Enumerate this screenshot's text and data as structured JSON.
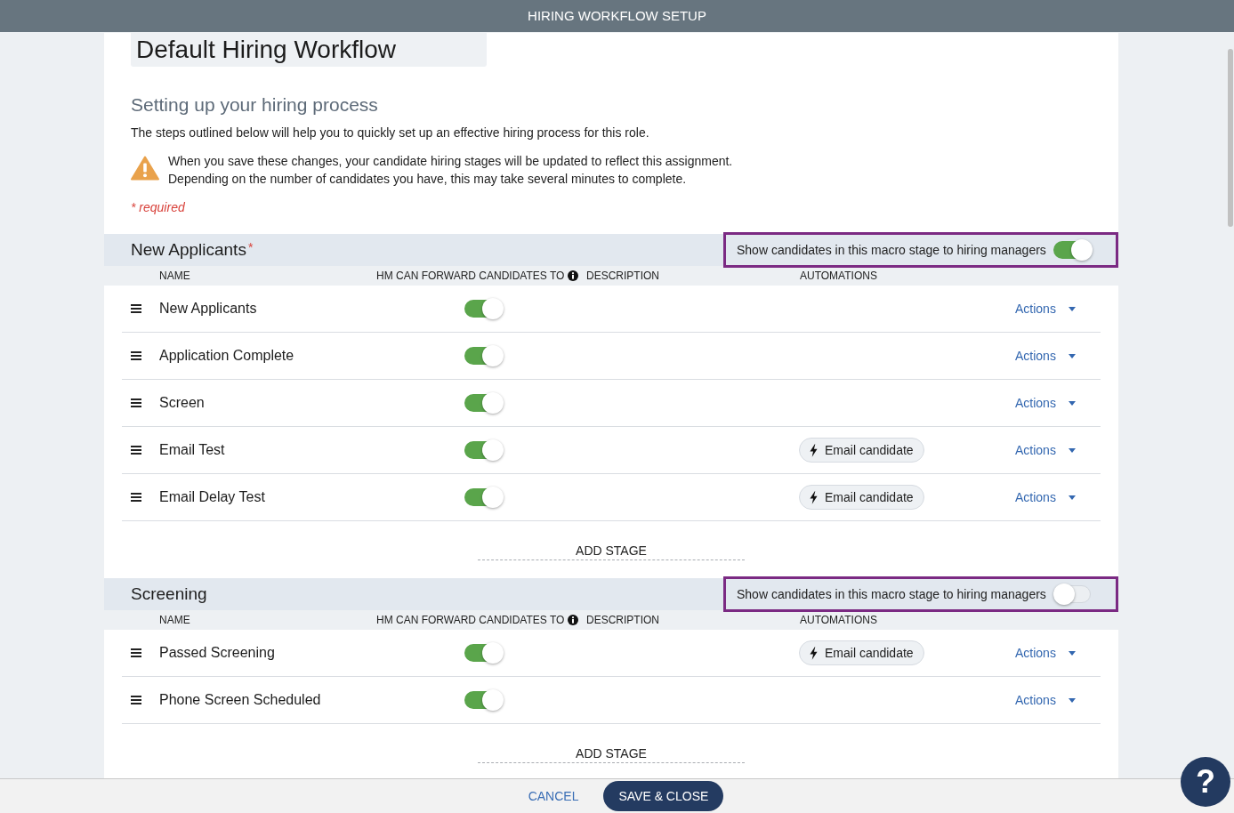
{
  "window": {
    "title": "HIRING WORKFLOW SETUP"
  },
  "workflow_name": {
    "value": "Default Hiring Workflow"
  },
  "intro": {
    "heading": "Setting up your hiring process",
    "description": "The steps outlined below will help you to quickly set up an effective hiring process for this role.",
    "warning_lines": [
      "When you save these changes, your candidate hiring stages will be updated to reflect this assignment.",
      "Depending on the number of candidates you have, this may take several minutes to complete."
    ],
    "required_note": "* required"
  },
  "sections": [
    {
      "title": "New Applicants",
      "required_mark": "*",
      "visibility": {
        "label": "Show candidates in this macro stage to hiring managers",
        "on": true,
        "highlighted": true
      },
      "columns": [
        {
          "label": "NAME",
          "info": false
        },
        {
          "label": "HM CAN FORWARD CANDIDATES TO",
          "info": true
        },
        {
          "label": "DESCRIPTION",
          "info": false
        },
        {
          "label": "AUTOMATIONS",
          "info": false
        }
      ],
      "stages": [
        {
          "name": "New Applicants",
          "hm_can_forward": true,
          "actions": "Actions"
        },
        {
          "name": "Application Complete",
          "hm_can_forward": true,
          "actions": "Actions"
        },
        {
          "name": "Screen",
          "hm_can_forward": true,
          "actions": "Actions"
        },
        {
          "name": "Email Test",
          "hm_can_forward": true,
          "automations": [
            "Email candidate"
          ],
          "actions": "Actions"
        },
        {
          "name": "Email Delay Test",
          "hm_can_forward": true,
          "automations": [
            "Email candidate"
          ],
          "actions": "Actions"
        }
      ],
      "add_stage": "ADD STAGE"
    },
    {
      "title": "Screening",
      "visibility": {
        "label": "Show candidates in this macro stage to hiring managers",
        "on": false,
        "highlighted": true
      },
      "columns": [
        {
          "label": "NAME",
          "info": false
        },
        {
          "label": "HM CAN FORWARD CANDIDATES TO",
          "info": true
        },
        {
          "label": "DESCRIPTION",
          "info": false
        },
        {
          "label": "AUTOMATIONS",
          "info": false
        }
      ],
      "stages": [
        {
          "name": "Passed Screening",
          "hm_can_forward": true,
          "automations": [
            "Email candidate"
          ],
          "actions": "Actions"
        },
        {
          "name": "Phone Screen Scheduled",
          "hm_can_forward": true,
          "actions": "Actions"
        }
      ],
      "add_stage": "ADD STAGE"
    }
  ],
  "footer": {
    "cancel": "CANCEL",
    "save": "SAVE & CLOSE"
  },
  "help_button": {
    "label": "?"
  }
}
